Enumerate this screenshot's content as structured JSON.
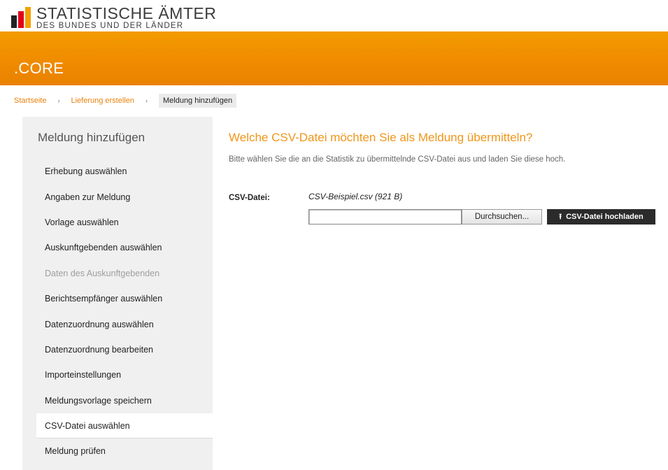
{
  "header": {
    "logo_line1": "STATISTISCHE ÄMTER",
    "logo_line2": "DES BUNDES UND DER LÄNDER",
    "app_title": ".CORE"
  },
  "breadcrumb": {
    "items": [
      "Startseite",
      "Lieferung erstellen",
      "Meldung hinzufügen"
    ],
    "separator": "›"
  },
  "sidebar": {
    "title": "Meldung hinzufügen",
    "items": [
      {
        "label": "Erhebung auswählen"
      },
      {
        "label": "Angaben zur Meldung"
      },
      {
        "label": "Vorlage auswählen"
      },
      {
        "label": "Auskunftgebenden auswählen"
      },
      {
        "label": "Daten des Auskunftgebenden"
      },
      {
        "label": "Berichtsempfänger auswählen"
      },
      {
        "label": "Datenzuordnung auswählen"
      },
      {
        "label": "Datenzuordnung bearbeiten"
      },
      {
        "label": "Importeinstellungen"
      },
      {
        "label": "Meldungsvorlage speichern"
      },
      {
        "label": "CSV-Datei auswählen"
      },
      {
        "label": "Meldung prüfen"
      }
    ]
  },
  "main": {
    "heading": "Welche CSV-Datei möchten Sie als Meldung übermitteln?",
    "description": "Bitte wählen Sie die an die Statistik zu übermittelnde CSV-Datei aus und laden Sie diese hoch.",
    "csv_label": "CSV-Datei:",
    "file_name": "CSV-Beispiel.csv (921 B)",
    "file_input_value": "",
    "browse_label": "Durchsuchen...",
    "upload_label": "CSV-Datei hochladen",
    "upload_icon": "upload-icon"
  },
  "colors": {
    "accent_orange": "#f0961a",
    "banner_orange": "#f08a00",
    "dark_button": "#2b2b2b"
  }
}
